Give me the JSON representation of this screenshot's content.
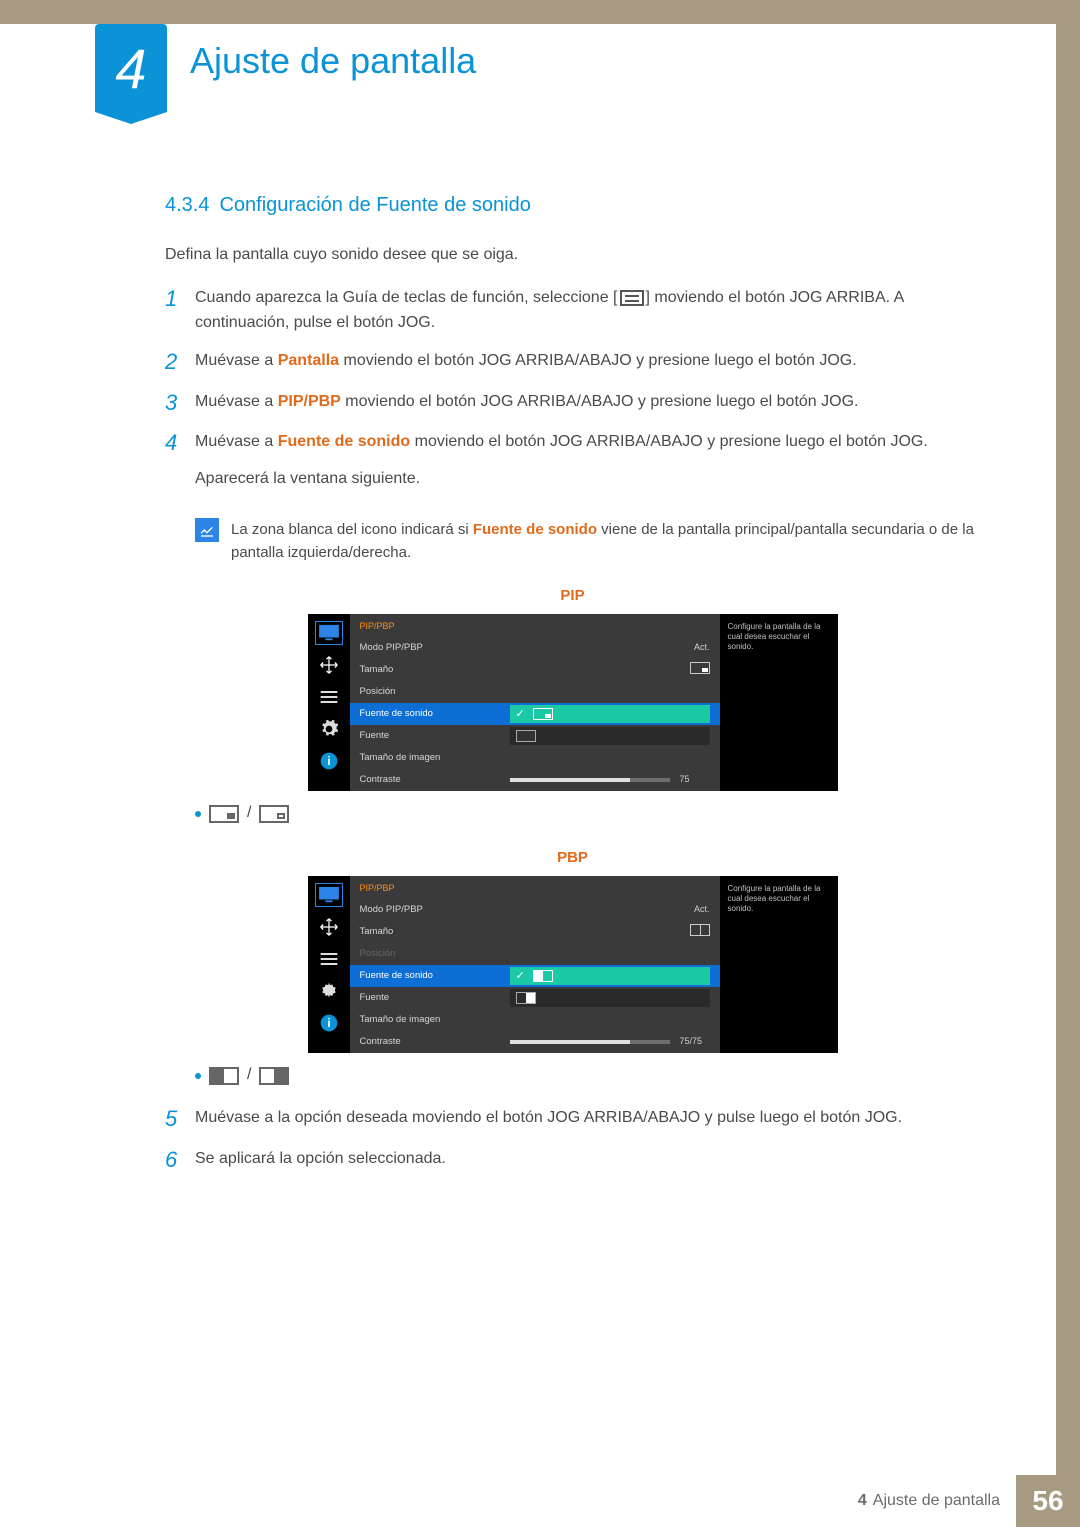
{
  "chapter": {
    "number": "4",
    "title": "Ajuste de pantalla"
  },
  "section": {
    "number": "4.3.4",
    "title": "Configuración de Fuente de sonido"
  },
  "intro": "Defina la pantalla cuyo sonido desee que se oiga.",
  "steps": {
    "s1a": "Cuando aparezca la Guía de teclas de función, seleccione [",
    "s1b": "] moviendo el botón JOG ARRIBA. A continuación, pulse el botón JOG.",
    "s2a": "Muévase a ",
    "s2kw": "Pantalla",
    "s2b": " moviendo el botón JOG ARRIBA/ABAJO y presione luego el botón JOG.",
    "s3a": "Muévase a ",
    "s3kw": "PIP/PBP",
    "s3b": " moviendo el botón JOG ARRIBA/ABAJO y presione luego el botón JOG.",
    "s4a": "Muévase a ",
    "s4kw": "Fuente de sonido",
    "s4b": " moviendo el botón JOG ARRIBA/ABAJO y presione luego el botón JOG.",
    "s4c": "Aparecerá la ventana siguiente.",
    "s5": "Muévase a la opción deseada moviendo el botón JOG ARRIBA/ABAJO y pulse luego el botón JOG.",
    "s6": "Se aplicará la opción seleccionada."
  },
  "note": {
    "a": "La zona blanca del icono indicará si ",
    "kw": "Fuente de sonido",
    "b": " viene de la pantalla principal/pantalla secundaria o de la pantalla izquierda/derecha."
  },
  "osd_labels": {
    "pip": "PIP",
    "pbp": "PBP"
  },
  "osd_common": {
    "header": "PIP/PBP",
    "help_text": "Configure la pantalla de la cual desea escuchar el sonido.",
    "rows": {
      "modo": "Modo PIP/PBP",
      "tamano": "Tamaño",
      "posicion": "Posición",
      "fuente_sonido": "Fuente de sonido",
      "fuente": "Fuente",
      "tamano_imagen": "Tamaño de imagen",
      "contraste": "Contraste"
    },
    "act": "Act."
  },
  "osd_pip": {
    "contraste_val": "75"
  },
  "osd_pbp": {
    "contraste_val": "75/75"
  },
  "legend_separator": "/",
  "footer": {
    "chapter_num": "4",
    "chapter_title": "Ajuste de pantalla",
    "page": "56"
  }
}
